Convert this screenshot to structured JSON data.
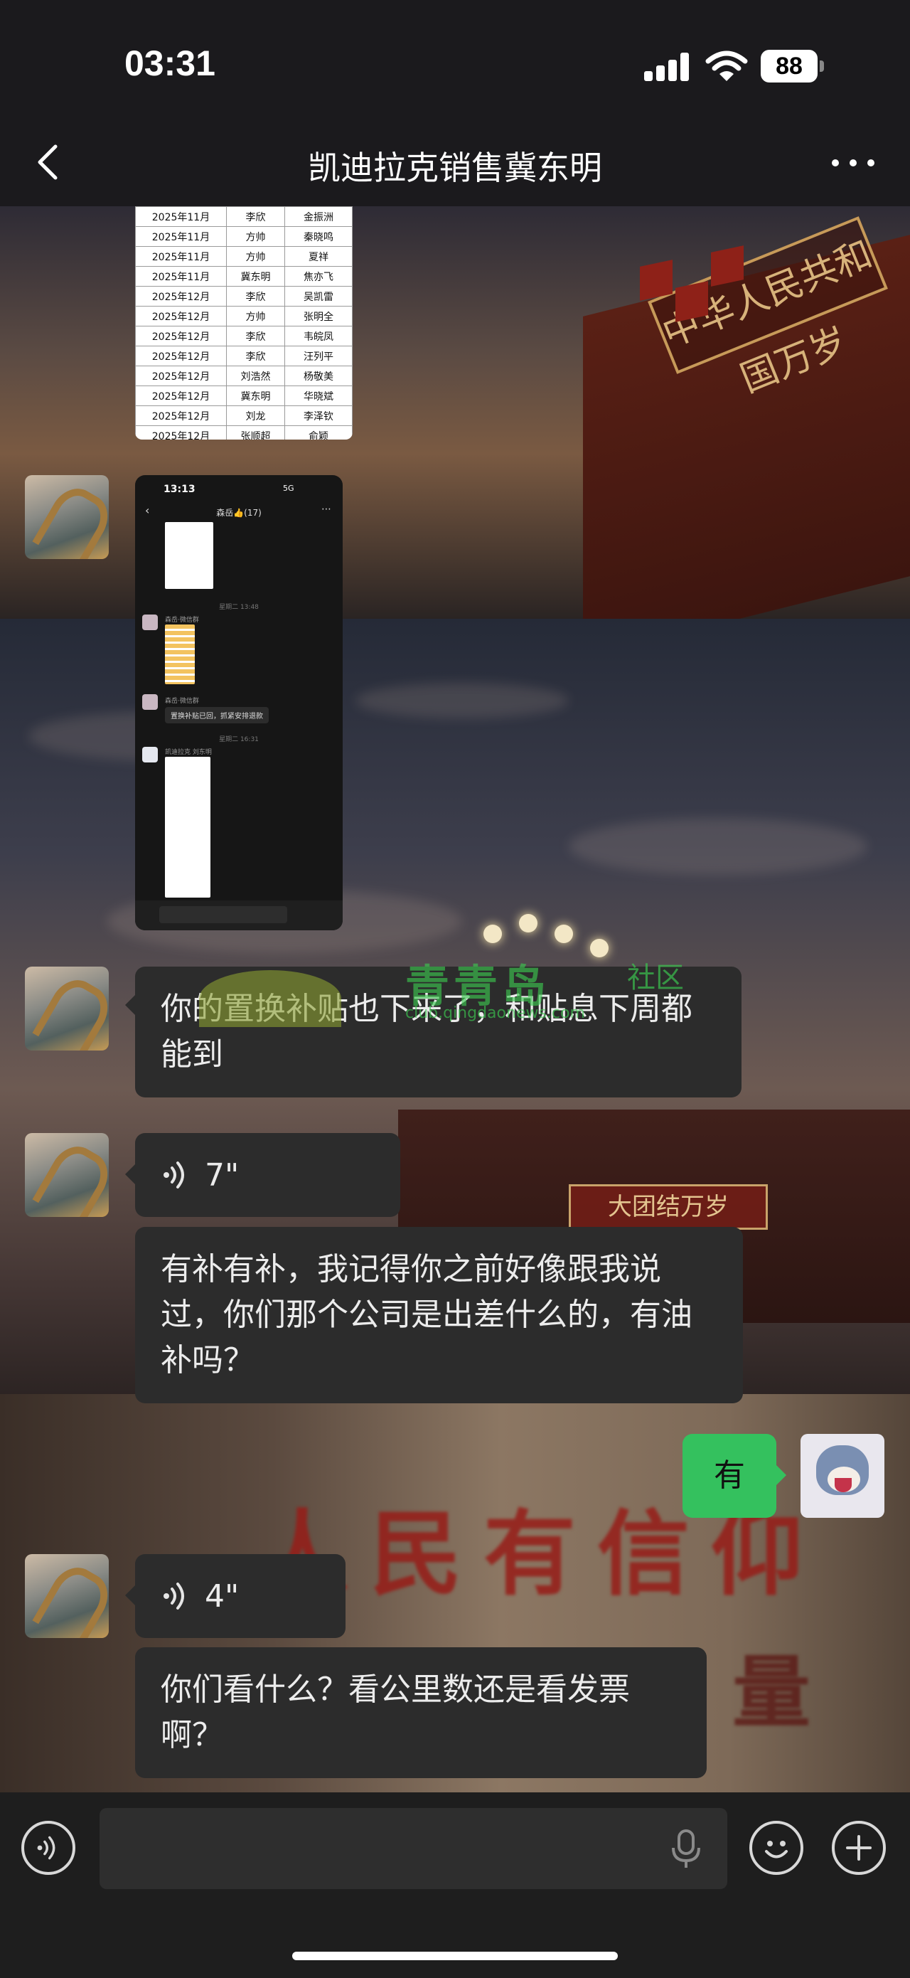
{
  "status_bar": {
    "time": "03:31",
    "battery": "88"
  },
  "nav": {
    "title": "凯迪拉克销售冀东明"
  },
  "table_image": {
    "rows": [
      [
        "2025年11月",
        "李欣",
        "金振洲"
      ],
      [
        "2025年11月",
        "方帅",
        "秦晓鸣"
      ],
      [
        "2025年11月",
        "方帅",
        "夏祥"
      ],
      [
        "2025年11月",
        "冀东明",
        "焦亦飞"
      ],
      [
        "2025年12月",
        "李欣",
        "吴凯雷"
      ],
      [
        "2025年12月",
        "方帅",
        "张明全"
      ],
      [
        "2025年12月",
        "李欣",
        "韦皖凤"
      ],
      [
        "2025年12月",
        "李欣",
        "汪列平"
      ],
      [
        "2025年12月",
        "刘浩然",
        "杨敬美"
      ],
      [
        "2025年12月",
        "冀东明",
        "华晓斌"
      ],
      [
        "2025年12月",
        "刘龙",
        "李泽钦"
      ],
      [
        "2025年12月",
        "张顺超",
        "俞颖"
      ]
    ]
  },
  "screenshot_image": {
    "time": "13:13",
    "status": "5G",
    "title": "森岳👍(17)",
    "stamp1": "星期二 13:48",
    "name1": "森岳·微信群",
    "name2": "森岳·微信群",
    "msg": "置换补贴已回，抓紧安排退款",
    "stamp2": "星期二 16:31",
    "name3": "凯迪拉克 刘东明"
  },
  "messages": {
    "m1": "你的置换补贴也下来了，和贴息下周都能到",
    "voice1": "7\"",
    "m2": "有补有补，我记得你之前好像跟我说过，你们那个公司是出差什么的，有油补吗？",
    "mine1": "有",
    "voice2": "4\"",
    "m3": "你们看什么？看公里数还是看发票啊？"
  },
  "watermark": {
    "text": "青青岛",
    "suffix": "社区",
    "url": "club.qingdaonews.com"
  },
  "background": {
    "sign_top": "中华人民共和国万岁",
    "sign_mid": "大团结万岁",
    "slogan": "人民有信仰",
    "slogan_tail": "量"
  },
  "colors": {
    "accent_green": "#34c15e",
    "bubble_dark": "#2c2c2c"
  }
}
